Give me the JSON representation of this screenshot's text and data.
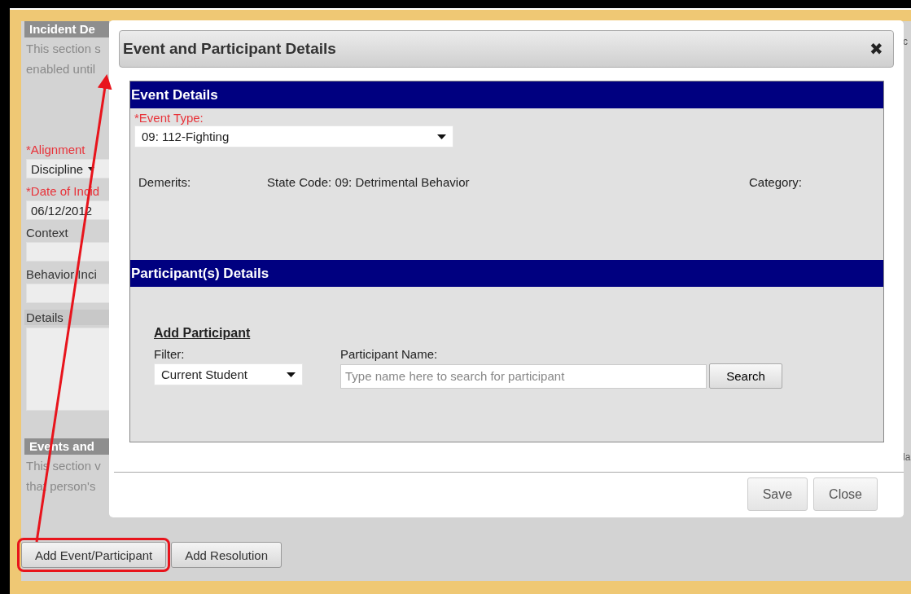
{
  "background_form": {
    "incident_section": {
      "header": "Incident De",
      "description": [
        "This section s",
        "enabled until"
      ]
    },
    "fields": [
      {
        "kind": "select",
        "label": "*Alignment",
        "required": true,
        "value": "Discipline"
      },
      {
        "kind": "input",
        "label": "*Date of Incid",
        "required": true,
        "value": "06/12/2012"
      },
      {
        "kind": "input",
        "label": "Context",
        "required": false
      },
      {
        "kind": "input",
        "label": "Behavior Inci",
        "required": false
      },
      {
        "kind": "textarea",
        "label": "Details",
        "required": false
      }
    ],
    "events_section": {
      "header": "Events and",
      "description": [
        "This section v",
        "that person's"
      ]
    },
    "right_edge_texts": [
      "c",
      "la"
    ],
    "buttons": [
      {
        "label": "Add Event/Participant",
        "highlighted": true
      },
      {
        "label": "Add Resolution",
        "highlighted": false
      }
    ]
  },
  "dialog": {
    "title": "Event and Participant Details",
    "close": "✖",
    "event_details": {
      "header": "Event Details",
      "event_type_label": "*Event Type:",
      "event_type_value": "09: 112-Fighting",
      "demerits": "Demerits:",
      "state_code": "State Code: 09: Detrimental Behavior",
      "category": "Category:"
    },
    "participant_details": {
      "header": "Participant(s) Details",
      "add_participant": "Add Participant",
      "filter_label": "Filter:",
      "filter_value": "Current Student",
      "name_label": "Participant Name:",
      "name_placeholder": "Type name here to search for participant",
      "search_button": "Search"
    },
    "buttons": [
      "Save",
      "Close"
    ]
  }
}
